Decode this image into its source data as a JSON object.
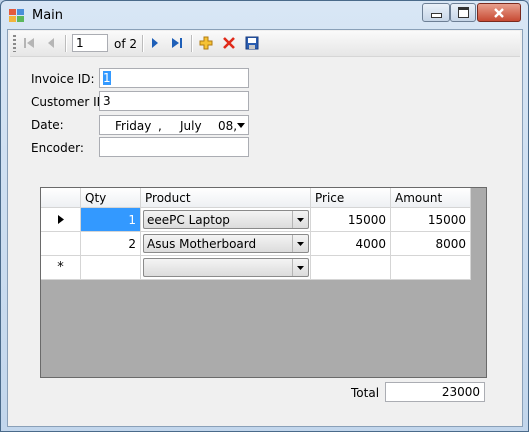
{
  "window": {
    "title": "Main"
  },
  "navigator": {
    "position": "1",
    "count_label": "of 2"
  },
  "form": {
    "invoice_label": "Invoice ID:",
    "invoice_value": "1",
    "customer_label": "Customer ID:",
    "customer_value": "3",
    "date_label": "Date:",
    "date_day": "Friday",
    "date_sep": ",",
    "date_month": "July",
    "date_daynum": "08,",
    "encoder_label": "Encoder:",
    "encoder_value": ""
  },
  "grid": {
    "columns": [
      "Qty",
      "Product",
      "Price",
      "Amount"
    ],
    "rows": [
      {
        "qty": "1",
        "product": "eeePC Laptop",
        "price": "15000",
        "amount": "15000",
        "current": true
      },
      {
        "qty": "2",
        "product": "Asus Motherboard",
        "price": "4000",
        "amount": "8000",
        "current": false
      }
    ],
    "new_row_marker": "*"
  },
  "footer": {
    "total_label": "Total",
    "total_value": "23000"
  },
  "icons": [
    "move-first-icon",
    "move-previous-icon",
    "move-next-icon",
    "move-last-icon",
    "add-new-icon",
    "delete-icon",
    "save-icon"
  ]
}
